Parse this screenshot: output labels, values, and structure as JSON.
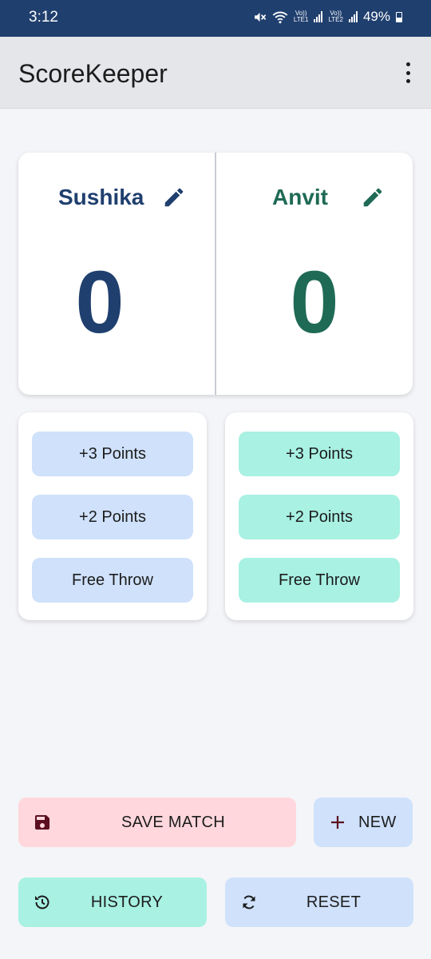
{
  "status_bar": {
    "time": "3:12",
    "battery": "49%",
    "sim1": "LTE1",
    "sim2": "LTE2",
    "volte": "Vo))"
  },
  "app_bar": {
    "title": "ScoreKeeper",
    "menu_icon": "more-vertical-icon"
  },
  "teams": [
    {
      "name": "Sushika",
      "score": "0",
      "color": "#1f3f6e",
      "button_color": "#cfe1fb"
    },
    {
      "name": "Anvit",
      "score": "0",
      "color": "#1f6a55",
      "button_color": "#a8f1e3"
    }
  ],
  "point_buttons": [
    "+3 Points",
    "+2 Points",
    "Free Throw"
  ],
  "bottom": {
    "save": "SAVE MATCH",
    "new": "NEW",
    "history": "HISTORY",
    "reset": "RESET"
  },
  "colors": {
    "header": "#1f3f6e",
    "save_bg": "#ffd7dc",
    "save_icon": "#5c0f1e"
  }
}
